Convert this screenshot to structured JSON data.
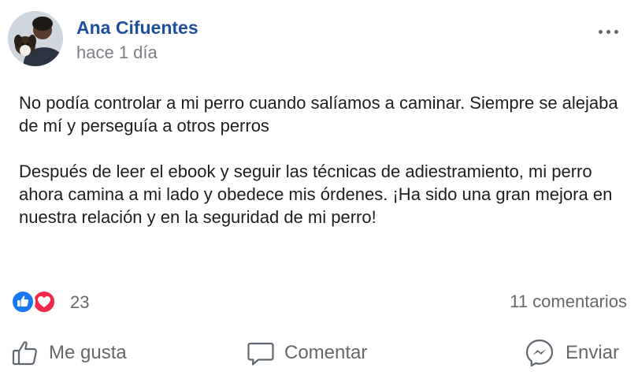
{
  "post": {
    "author": "Ana Cifuentes",
    "timestamp": "hace 1 día",
    "paragraphs": [
      "No podía controlar a mi perro cuando salíamos a caminar. Siempre se alejaba de mí y perseguía a otros perros",
      "Después de leer el ebook y seguir las técnicas de adiestramiento, mi perro ahora camina a mi lado y obedece mis órdenes. ¡Ha sido una gran mejora en nuestra relación y en la seguridad de mi perro!"
    ]
  },
  "reactions": {
    "count": "23",
    "types": [
      "like-icon",
      "love-icon"
    ],
    "comments": "11 comentarios"
  },
  "actions": {
    "like_label": "Me gusta",
    "comment_label": "Comentar",
    "send_label": "Enviar"
  },
  "colors": {
    "author_name": "#1d4f9c",
    "secondary_text": "#65676b",
    "like_blue": "#1877f2",
    "love_red": "#f0284a"
  }
}
